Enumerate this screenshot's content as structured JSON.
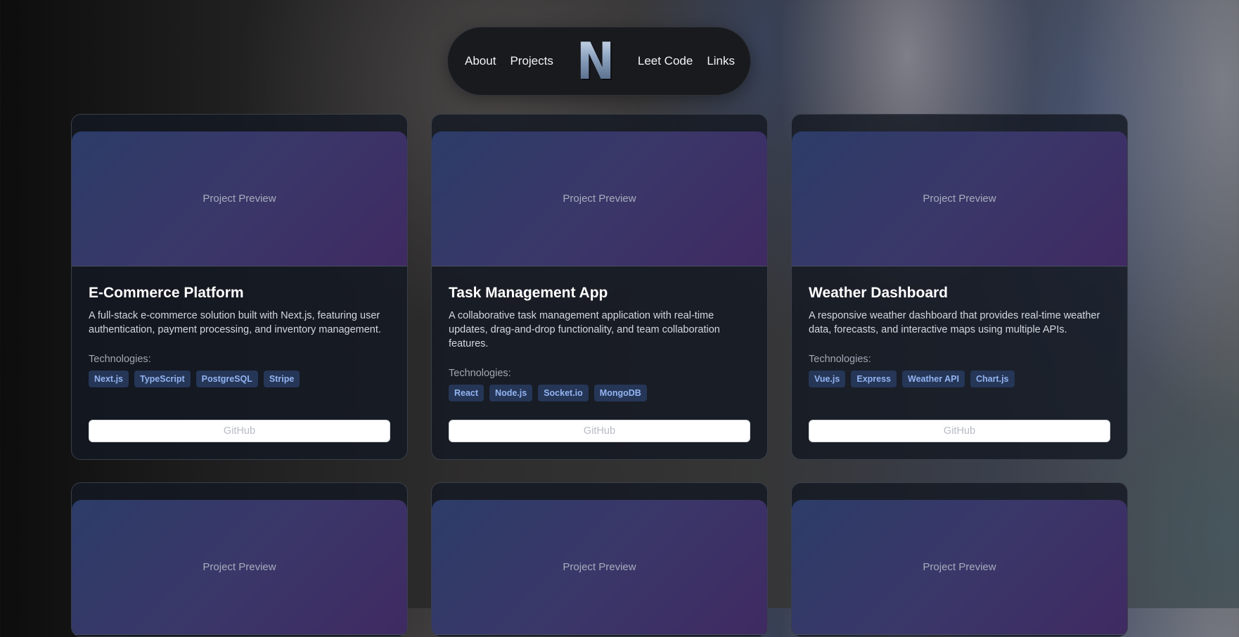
{
  "nav": {
    "about": "About",
    "projects": "Projects",
    "logo": "N",
    "leetcode": "Leet Code",
    "links": "Links"
  },
  "projects": [
    {
      "preview": "Project Preview",
      "title": "E-Commerce Platform",
      "description": "A full-stack e-commerce solution built with Next.js, featuring user authentication, payment processing, and inventory management.",
      "tech_label": "Technologies:",
      "tags": [
        "Next.js",
        "TypeScript",
        "PostgreSQL",
        "Stripe"
      ],
      "button": "GitHub"
    },
    {
      "preview": "Project Preview",
      "title": "Task Management App",
      "description": "A collaborative task management application with real-time updates, drag-and-drop functionality, and team collaboration features.",
      "tech_label": "Technologies:",
      "tags": [
        "React",
        "Node.js",
        "Socket.io",
        "MongoDB"
      ],
      "button": "GitHub"
    },
    {
      "preview": "Project Preview",
      "title": "Weather Dashboard",
      "description": "A responsive weather dashboard that provides real-time weather data, forecasts, and interactive maps using multiple APIs.",
      "tech_label": "Technologies:",
      "tags": [
        "Vue.js",
        "Express",
        "Weather API",
        "Chart.js"
      ],
      "button": "GitHub"
    },
    {
      "preview": "Project Preview"
    },
    {
      "preview": "Project Preview"
    },
    {
      "preview": "Project Preview"
    }
  ],
  "colors": {
    "card_bg": "#141822",
    "tag_bg": "#253657",
    "tag_text": "#93b4f2",
    "preview_gradient_start": "#2c3c68",
    "preview_gradient_end": "#3f2a62"
  }
}
